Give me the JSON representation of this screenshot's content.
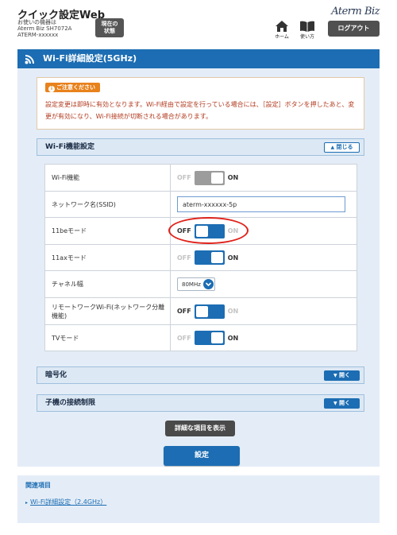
{
  "header": {
    "app_title": "クイック設定Web",
    "device_label": "お使いの機器は",
    "device_model": "Aterm Biz SH7072A",
    "device_id": "ATERM-xxxxxx",
    "status_button": "現在の\n状態",
    "brand": "Aterm Biz",
    "nav": {
      "home": "ホーム",
      "guide": "使い方"
    },
    "logout": "ログアウト"
  },
  "page": {
    "title": "Wi-Fi詳細設定(5GHz)"
  },
  "notice": {
    "badge": "ご注意ください",
    "text": "設定変更は即時に有効となります。Wi-Fi経由で設定を行っている場合には、［設定］ボタンを押したあと、変更が有効になり、Wi-Fi接続が切断される場合があります。"
  },
  "sections": {
    "wifi_function": {
      "title": "Wi-Fi機能設定",
      "toggle": "閉じる"
    },
    "encryption": {
      "title": "暗号化",
      "toggle": "開く"
    },
    "client_restriction": {
      "title": "子機の接続制限",
      "toggle": "開く"
    }
  },
  "settings": {
    "wifi_function": {
      "label": "Wi-Fi機能",
      "off": "OFF",
      "on": "ON",
      "state": "disabled"
    },
    "ssid": {
      "label": "ネットワーク名(SSID)",
      "value": "aterm-xxxxxx-5p"
    },
    "mode_11be": {
      "label": "11beモード",
      "off": "OFF",
      "on": "ON",
      "state": "off"
    },
    "mode_11ax": {
      "label": "11axモード",
      "off": "OFF",
      "on": "ON",
      "state": "on"
    },
    "channel_width": {
      "label": "チャネル幅",
      "value": "80MHz"
    },
    "remote_work_wifi": {
      "label": "リモートワークWi-Fi(ネットワーク分離機能)",
      "off": "OFF",
      "on": "ON",
      "state": "off"
    },
    "tv_mode": {
      "label": "TVモード",
      "off": "OFF",
      "on": "ON",
      "state": "on"
    }
  },
  "buttons": {
    "show_advanced": "詳細な項目を表示",
    "apply": "設定"
  },
  "related": {
    "title": "関連項目",
    "link": "Wi-Fi詳細設定（2.4GHz）"
  },
  "colors": {
    "primary": "#1c6db3",
    "notice_text": "#b23a1f",
    "notice_badge": "#e8821c",
    "highlight": "#e0221a",
    "panel_bg": "#e4edf7"
  }
}
